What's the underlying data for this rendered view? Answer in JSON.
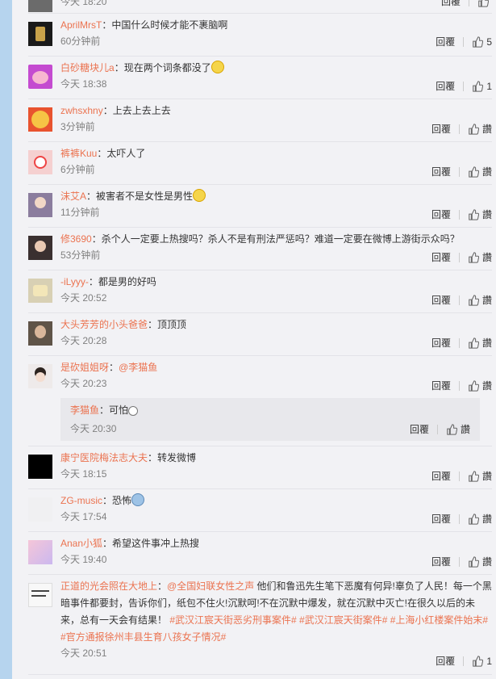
{
  "top_row": {
    "time": "今天 18:20",
    "reply_label": "回覆",
    "like_label": ""
  },
  "comments": [
    {
      "user": "AprilMrsT",
      "text": "中国什么时候才能不裹脑啊",
      "time": "60分钟前",
      "reply_label": "回覆",
      "like_label": "5"
    },
    {
      "user": "白砂糖块儿a",
      "text": "现在两个词条都没了",
      "time": "今天 18:38",
      "reply_label": "回覆",
      "like_label": "1"
    },
    {
      "user": "zwhsxhny",
      "text": "上去上去上去",
      "time": "3分钟前",
      "reply_label": "回覆",
      "like_label": "讚"
    },
    {
      "user": "裤裤Kuu",
      "text": "太吓人了",
      "time": "6分钟前",
      "reply_label": "回覆",
      "like_label": "讚"
    },
    {
      "user": "沫艾A",
      "text": "被害者不是女性是男性",
      "time": "11分钟前",
      "reply_label": "回覆",
      "like_label": "讚"
    },
    {
      "user": "修3690",
      "text": "杀个人一定要上热搜吗？杀人不是有刑法严惩吗？难道一定要在微博上游街示众吗？",
      "time": "53分钟前",
      "reply_label": "回覆",
      "like_label": "讚"
    },
    {
      "user": "-iLyyy-",
      "text": "都是男的好吗",
      "time": "今天 20:52",
      "reply_label": "回覆",
      "like_label": "讚"
    },
    {
      "user": "大头芳芳的小头爸爸",
      "text": "顶顶顶",
      "time": "今天 20:28",
      "reply_label": "回覆",
      "like_label": "讚"
    },
    {
      "user": "是砍姐姐呀",
      "mention": "@李猫鱼",
      "text": "",
      "time": "今天 20:23",
      "reply_label": "回覆",
      "like_label": "讚"
    },
    {
      "user": "康宁医院梅法志大夫",
      "text": "转发微博",
      "time": "今天 18:15",
      "reply_label": "回覆",
      "like_label": "讚"
    },
    {
      "user": "ZG-music",
      "text": "恐怖",
      "time": "今天 17:54",
      "reply_label": "回覆",
      "like_label": "讚"
    },
    {
      "user": "Anan小狐",
      "text": "希望这件事冲上热搜",
      "time": "今天 19:40",
      "reply_label": "回覆",
      "like_label": "讚"
    },
    {
      "user": "正道的光会照在大地上",
      "mention": "@全国妇联女性之声",
      "text": " 他们和鲁迅先生笔下恶魔有何异!辜负了人民！每一个黑暗事件都要封，告诉你们，纸包不住火!沉默呵!不在沉默中爆发，就在沉默中灭亡!在很久以后的未来，总有一天会有结果！",
      "hashtags": "#武汉江宸天街恶劣刑事案件# #武汉江宸天街案件# #上海小红楼案件始末# #官方通报徐州丰县生育八孩女子情况#",
      "time": "今天 20:51",
      "reply_label": "回覆",
      "like_label": "1"
    }
  ],
  "subreply": {
    "user": "李猫鱼",
    "text": "可怕",
    "time": "今天 20:30",
    "reply_label": "回覆",
    "like_label": "讚"
  },
  "colors": {
    "username": "#eb7350",
    "background": "#f2f2f5",
    "left_bar": "#b6d4ee"
  }
}
